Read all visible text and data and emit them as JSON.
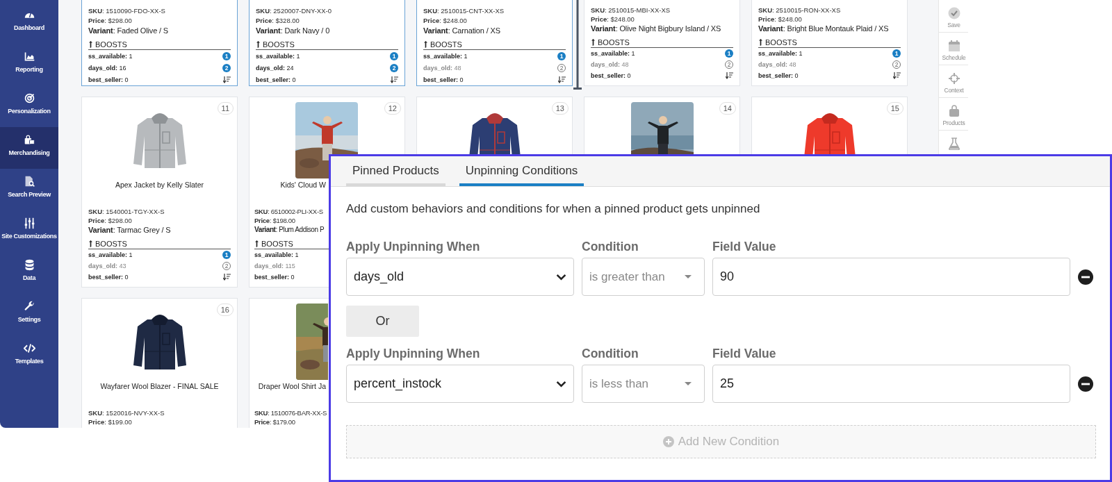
{
  "sidebar": {
    "items": [
      {
        "label": "Dashboard",
        "selected": false
      },
      {
        "label": "Reporting",
        "selected": false
      },
      {
        "label": "Personalization",
        "selected": false
      },
      {
        "label": "Merchandising",
        "selected": true
      },
      {
        "label": "Search Preview",
        "selected": false
      },
      {
        "label": "Site Customizations",
        "selected": false
      },
      {
        "label": "Data",
        "selected": false
      },
      {
        "label": "Settings",
        "selected": false
      },
      {
        "label": "Templates",
        "selected": false
      }
    ]
  },
  "cards": [
    {
      "selected": true,
      "sku": "**SKU**: 1510090-FDO-XX-S",
      "price": "**Price**: $298.00",
      "variant": "**Variant**: Faded Olive / S",
      "boosts_heading": "BOOSTS",
      "boosts": [
        {
          "text": "**ss_available:** 1",
          "muted": false,
          "badge": {
            "kind": "filled",
            "text": "1"
          }
        },
        {
          "text": "**days_old:** 16",
          "muted": false,
          "badge": {
            "kind": "filled",
            "text": "2"
          }
        },
        {
          "text": "**best_seller:** 0",
          "muted": false,
          "badge": {
            "kind": "sort"
          }
        }
      ]
    },
    {
      "selected": true,
      "sku": "**SKU**: 2520007-DNY-XX-0",
      "price": "**Price**: $328.00",
      "variant": "**Variant**: Dark Navy / 0",
      "boosts_heading": "BOOSTS",
      "boosts": [
        {
          "text": "**ss_available:** 1",
          "muted": false,
          "badge": {
            "kind": "filled",
            "text": "1"
          }
        },
        {
          "text": "**days_old:** 24",
          "muted": false,
          "badge": {
            "kind": "filled",
            "text": "2"
          }
        },
        {
          "text": "**best_seller:** 0",
          "muted": false,
          "badge": {
            "kind": "sort"
          }
        }
      ]
    },
    {
      "selected": true,
      "sku": "**SKU**: 2510015-CNT-XX-XS",
      "price": "**Price**: $248.00",
      "variant": "**Variant**: Carnation / XS",
      "boosts_heading": "BOOSTS",
      "boosts": [
        {
          "text": "**ss_available:** 1",
          "muted": false,
          "badge": {
            "kind": "filled",
            "text": "1"
          }
        },
        {
          "text": "**days_old:** 48",
          "muted": true,
          "badge": {
            "kind": "outline",
            "text": "2"
          }
        },
        {
          "text": "**best_seller:** 0",
          "muted": false,
          "badge": {
            "kind": "sort"
          }
        }
      ]
    },
    {
      "selected": false,
      "sku": "**SKU**: 2510015-MBI-XX-XS",
      "price": "**Price**: $248.00",
      "variant": "**Variant**: Olive Night Bigbury Island / XS",
      "boosts_heading": "BOOSTS",
      "boosts": [
        {
          "text": "**ss_available:** 1",
          "muted": false,
          "badge": {
            "kind": "filled",
            "text": "1"
          }
        },
        {
          "text": "**days_old:** 48",
          "muted": true,
          "badge": {
            "kind": "outline",
            "text": "2"
          }
        },
        {
          "text": "**best_seller:** 0",
          "muted": false,
          "badge": {
            "kind": "sort"
          }
        }
      ]
    },
    {
      "selected": false,
      "sku": "**SKU**: 2510015-RON-XX-XS",
      "price": "**Price**: $248.00",
      "variant": "**Variant**: Bright Blue Montauk Plaid / XS",
      "boosts_heading": "BOOSTS",
      "boosts": [
        {
          "text": "**ss_available:** 1",
          "muted": false,
          "badge": {
            "kind": "filled",
            "text": "1"
          }
        },
        {
          "text": "**days_old:** 48",
          "muted": true,
          "badge": {
            "kind": "outline",
            "text": "2"
          }
        },
        {
          "text": "**best_seller:** 0",
          "muted": false,
          "badge": {
            "kind": "sort"
          }
        }
      ]
    },
    {
      "selected": false,
      "number": "11",
      "image": {
        "kind": "picture"
      },
      "name": "Apex Jacket by Kelly Slater",
      "sku": "**SKU**: 1540001-TGY-XX-S",
      "price": "**Price**: $298.00",
      "variant": "**Variant**: Tarmac Grey / S",
      "boosts_heading": "BOOSTS",
      "boosts": [
        {
          "text": "**ss_available:** 1",
          "muted": false,
          "badge": {
            "kind": "filled",
            "text": "1"
          }
        },
        {
          "text": "**days_old:** 43",
          "muted": true,
          "badge": {
            "kind": "outline",
            "text": "2"
          }
        },
        {
          "text": "**best_seller:** 0",
          "muted": false,
          "badge": {
            "kind": "sort"
          }
        }
      ]
    },
    {
      "selected": false,
      "number": "12",
      "image": {
        "kind": "picture"
      },
      "name": "Kids' Cloud W",
      "sku": "**SKU**: 6510002-PLI-XX-S",
      "price": "**Price**: $198.00",
      "variant": "**Variant**: Plum Addison P",
      "boosts_heading": "BOOSTS",
      "boosts": [
        {
          "text": "**ss_available:** 1",
          "muted": false
        },
        {
          "text": "**days_old:** 115",
          "muted": true
        },
        {
          "text": "**best_seller:** 0",
          "muted": false
        }
      ]
    },
    {
      "selected": false,
      "number": "13",
      "image": {
        "kind": "picture"
      }
    },
    {
      "selected": false,
      "number": "14",
      "image": {
        "kind": "picture"
      }
    },
    {
      "selected": false,
      "number": "15",
      "image": {
        "kind": "picture"
      }
    },
    {
      "selected": false,
      "number": "16",
      "image": {
        "kind": "picture"
      },
      "name": "Wayfarer Wool Blazer - FINAL SALE",
      "sku": "**SKU**: 1520016-NVY-XX-S",
      "price": "**Price**: $199.00"
    },
    {
      "selected": false,
      "image": {
        "kind": "picture"
      },
      "name": "Draper Wool Shirt Ja",
      "sku": "**SKU**: 1510076-BAR-XX-S",
      "price": "**Price**: $179.00"
    }
  ],
  "toolbar": {
    "items": [
      {
        "label": "Save"
      },
      {
        "label": "Schedule"
      },
      {
        "label": "Context"
      },
      {
        "label": "Products"
      }
    ]
  },
  "panel": {
    "tabs": [
      {
        "label": "Pinned Products",
        "selected": false
      },
      {
        "label": "Unpinning Conditions",
        "selected": true
      }
    ],
    "description": "Add custom behaviors and conditions for when a pinned product gets unpinned",
    "conditions": [
      {
        "fields": [
          {
            "kind": "dropdown",
            "label": "Apply Unpinning When",
            "value": "days_old"
          },
          {
            "kind": "select",
            "label": "Condition",
            "value": "is greater than"
          },
          {
            "kind": "text",
            "label": "Field Value",
            "value": "90"
          }
        ]
      },
      {
        "fields": [
          {
            "kind": "dropdown",
            "label": "Apply Unpinning When",
            "value": "percent_instock"
          },
          {
            "kind": "select",
            "label": "Condition",
            "value": "is less than"
          },
          {
            "kind": "text",
            "label": "Field Value",
            "value": "25"
          }
        ]
      }
    ],
    "or_label": "Or",
    "add_button": {
      "label": "Add New Condition",
      "disabled": true
    }
  }
}
